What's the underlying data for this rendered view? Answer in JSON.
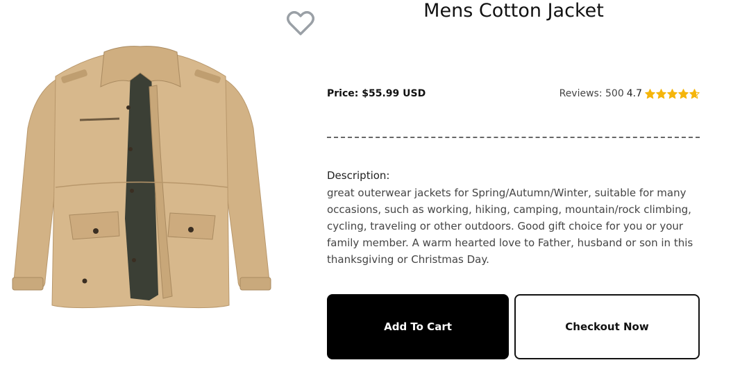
{
  "product": {
    "title": "Mens Cotton Jacket",
    "image_alt": "khaki cotton jacket",
    "price_label": "Price: $55.99 USD",
    "reviews_label": "Reviews: 500",
    "rating": "4.7",
    "rating_value": 4.7,
    "rating_max": 5,
    "description_label": "Description:",
    "description": "great outerwear jackets for Spring/Autumn/Winter, suitable for many occasions, such as working, hiking, camping, mountain/rock climbing, cycling, traveling or other outdoors. Good gift choice for you or your family member. A warm hearted love to Father, husband or son in this thanksgiving or Christmas Day."
  },
  "actions": {
    "add_to_cart": "Add To Cart",
    "checkout": "Checkout Now"
  },
  "icons": {
    "wishlist": "heart-outline-icon",
    "star": "star-icon"
  },
  "colors": {
    "star": "#f5b50a",
    "heart": "#9aa0a6",
    "primary_button": "#000000",
    "jacket": "#d3b48a"
  }
}
